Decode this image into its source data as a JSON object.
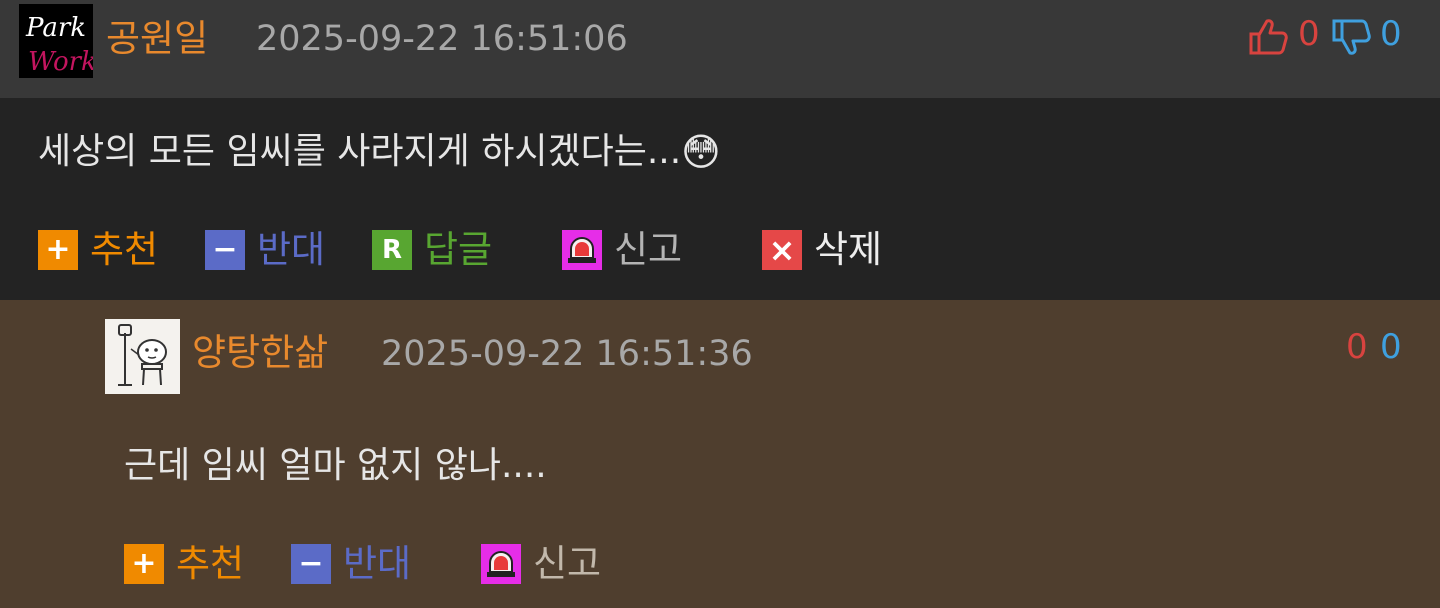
{
  "comment": {
    "author": "공원일",
    "timestamp": "2025-09-22 16:51:06",
    "likes": "0",
    "dislikes": "0",
    "avatar_text_top": "Park",
    "avatar_text_bottom": "Work",
    "body": "세상의 모든 임씨를 사라지게 하시겠다는...",
    "emoji": "😳",
    "actions": {
      "recommend": "추천",
      "oppose": "반대",
      "reply": "답글",
      "report": "신고",
      "delete": "삭제"
    },
    "action_icons": {
      "recommend": "+",
      "oppose": "−",
      "reply": "R",
      "delete": "×"
    }
  },
  "reply": {
    "author": "양탕한삶",
    "timestamp": "2025-09-22 16:51:36",
    "likes": "0",
    "dislikes": "0",
    "body": "근데 임씨 얼마 없지 않나....",
    "actions": {
      "recommend": "추천",
      "oppose": "반대",
      "report": "신고"
    }
  },
  "colors": {
    "author": "#e8892d",
    "like": "#d8433f",
    "dislike": "#3fa0df",
    "recommend": "#f08a00",
    "oppose": "#5b6bc7",
    "reply": "#58a631",
    "report_bg": "#e62de8",
    "delete": "#e54848"
  }
}
